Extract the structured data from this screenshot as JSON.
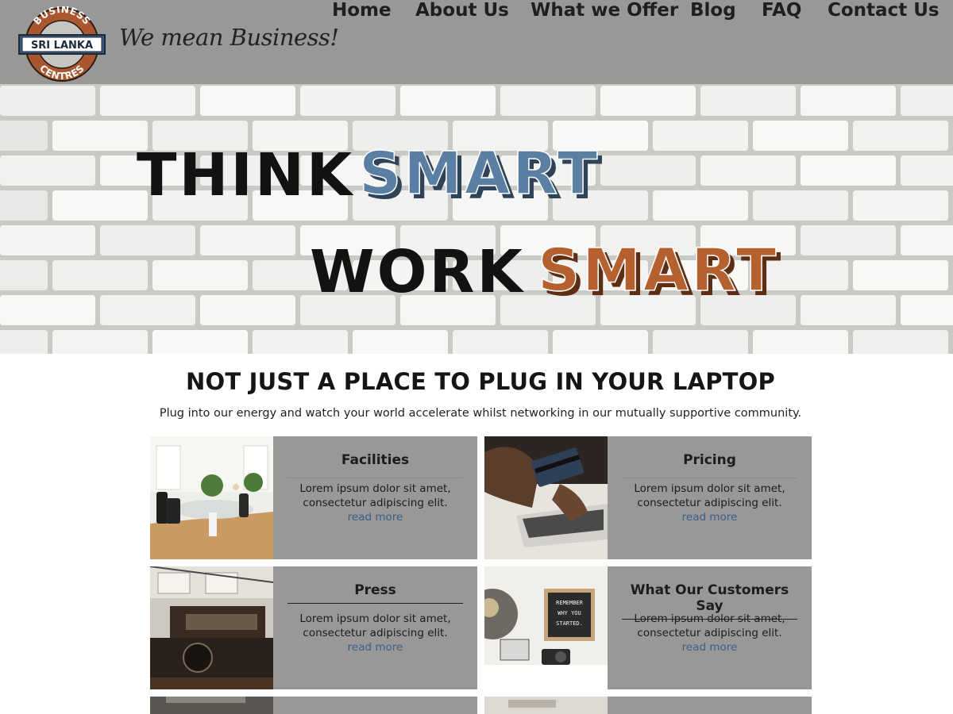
{
  "header": {
    "logo": {
      "top_arc": "BUSINESS",
      "band": "SRI LANKA",
      "bottom_arc": "CENTRES"
    },
    "tagline": "We mean Business!",
    "nav": [
      "Home",
      "About Us",
      "What we Offer",
      "Blog",
      "FAQ",
      "Contact Us"
    ]
  },
  "hero": {
    "line1": {
      "word1": "THINK",
      "word2": "SMART"
    },
    "line2": {
      "word1": "WORK",
      "word2": "SMART"
    },
    "colors": {
      "smart_blue": "#5b7ea3",
      "smart_orange": "#b5602f",
      "dark": "#121212",
      "brick": "#f2f2f0",
      "mortar": "#c9c9c5"
    }
  },
  "intro": {
    "title": "NOT JUST A PLACE TO PLUG IN YOUR LAPTOP",
    "subtitle": "Plug into our energy and watch your world accelerate whilst networking in our mutually supportive community."
  },
  "cards": [
    {
      "title": "Facilities",
      "text": "Lorem ipsum dolor sit amet, consectetur adipiscing elit.",
      "link": "read more",
      "image": "office-photo"
    },
    {
      "title": "Pricing",
      "text": "Lorem ipsum dolor sit amet, consectetur adipiscing elit.",
      "link": "read more",
      "image": "card-payment-photo"
    },
    {
      "title": "Press",
      "text": "Lorem ipsum dolor sit amet, consectetur adipiscing elit.",
      "link": "read more",
      "image": "printing-press-photo"
    },
    {
      "title": "What Our Customers Say",
      "text": "Lorem ipsum dolor sit amet, consectetur adipiscing elit.",
      "link": "read more",
      "image": "desk-shelf-photo"
    }
  ],
  "theme": {
    "header_bg": "#999896",
    "card_bg": "#9a9896",
    "link": "#3a5f8c"
  }
}
